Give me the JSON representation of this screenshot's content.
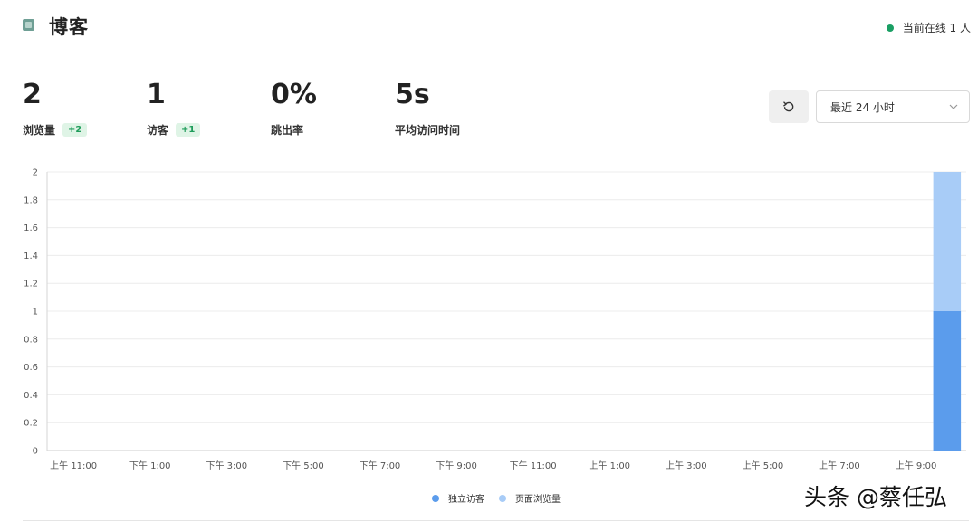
{
  "header": {
    "site_title": "博客",
    "online_text": "当前在线 1 人",
    "online_color": "#1a9f64"
  },
  "metrics": [
    {
      "value": "2",
      "label": "浏览量",
      "badge": "+2"
    },
    {
      "value": "1",
      "label": "访客",
      "badge": "+1"
    },
    {
      "value": "0%",
      "label": "跳出率",
      "badge": ""
    },
    {
      "value": "5s",
      "label": "平均访问时间",
      "badge": ""
    }
  ],
  "controls": {
    "refresh_icon": "refresh-icon",
    "range_selected": "最近 24 小时",
    "dropdown_icon": "chevron-down-icon"
  },
  "chart_data": {
    "type": "bar",
    "stacked": true,
    "x_tick_labels": [
      "上午 11:00",
      "下午 1:00",
      "下午 3:00",
      "下午 5:00",
      "下午 7:00",
      "下午 9:00",
      "下午 11:00",
      "上午 1:00",
      "上午 3:00",
      "上午 5:00",
      "上午 7:00",
      "上午 9:00"
    ],
    "y_ticks": [
      0,
      0.2,
      0.4,
      0.6,
      0.8,
      1,
      1.2,
      1.4,
      1.6,
      1.8,
      2
    ],
    "ylim": [
      0,
      2
    ],
    "grid": true,
    "legend_position": "bottom",
    "hours": 24,
    "series": [
      {
        "name": "独立访客",
        "color": "#5b9cec",
        "values": [
          0,
          0,
          0,
          0,
          0,
          0,
          0,
          0,
          0,
          0,
          0,
          0,
          0,
          0,
          0,
          0,
          0,
          0,
          0,
          0,
          0,
          0,
          0,
          1
        ]
      },
      {
        "name": "页面浏览量",
        "color": "#a8ccf7",
        "values": [
          0,
          0,
          0,
          0,
          0,
          0,
          0,
          0,
          0,
          0,
          0,
          0,
          0,
          0,
          0,
          0,
          0,
          0,
          0,
          0,
          0,
          0,
          0,
          2
        ]
      }
    ]
  },
  "watermark": "头条 @蔡任弘"
}
